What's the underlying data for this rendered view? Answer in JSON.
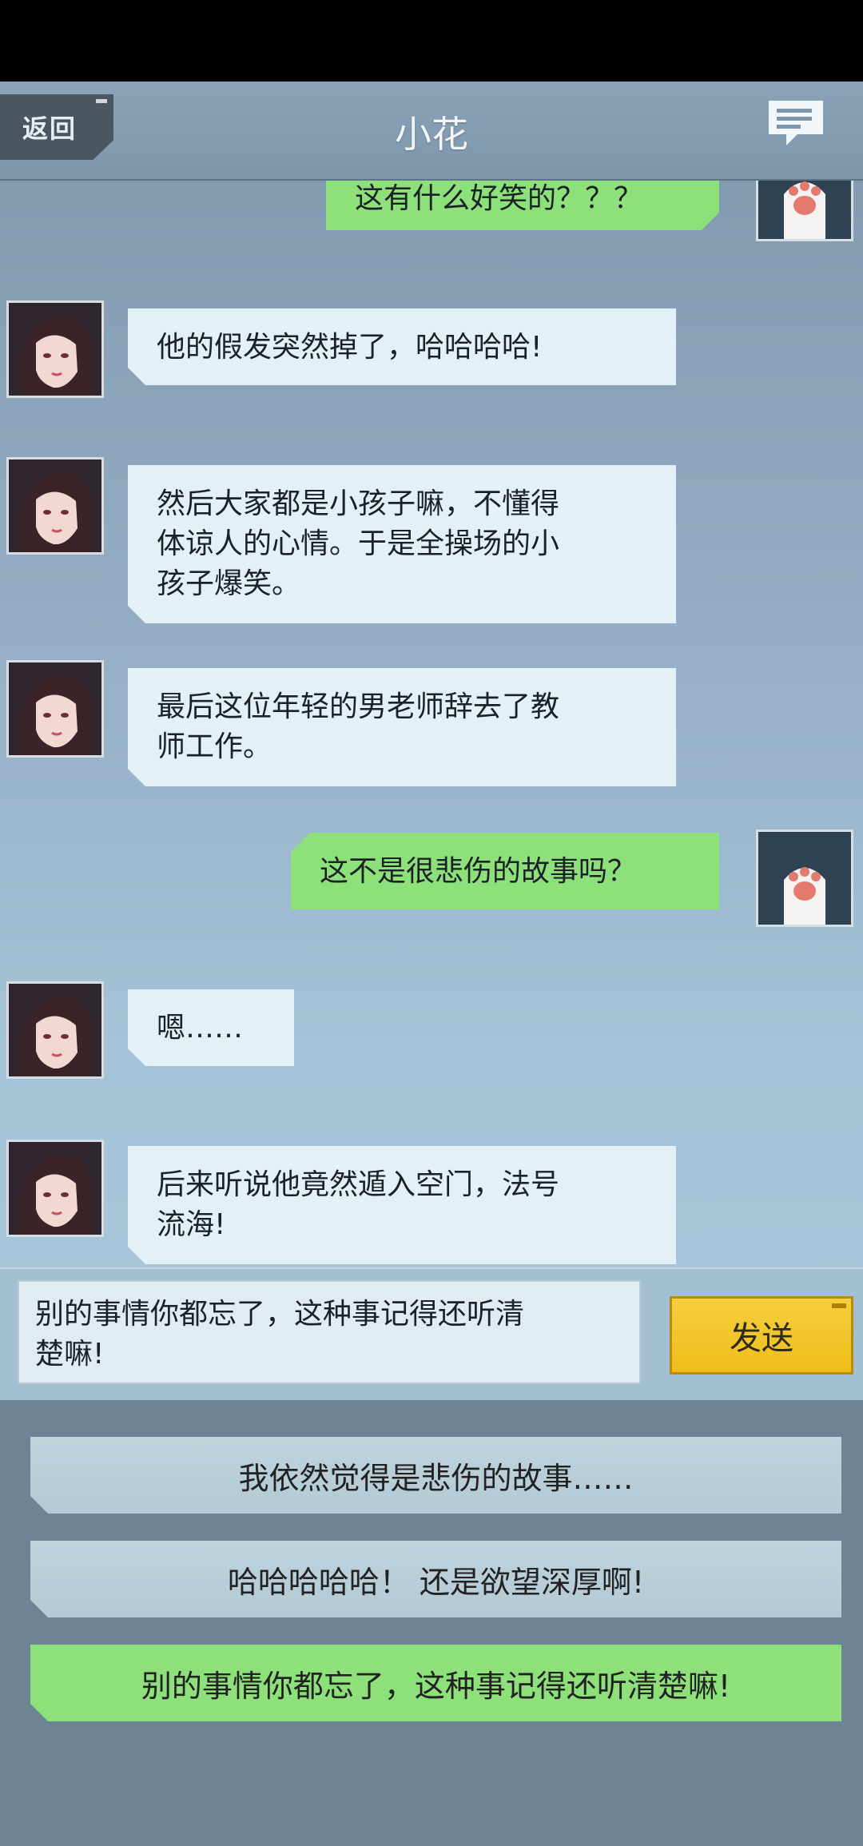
{
  "header": {
    "back_label": "返回",
    "title": "小花",
    "chat_icon": "chat-bubble-icon"
  },
  "messages": [
    {
      "side": "right",
      "avatar": "cat-paw",
      "text": "这有什么好笑的？？？"
    },
    {
      "side": "left",
      "avatar": "girl",
      "text": "他的假发突然掉了，哈哈哈哈!"
    },
    {
      "side": "left",
      "avatar": "girl",
      "lines": [
        "然后大家都是小孩子嘛，不懂得",
        "体谅人的心情。于是全操场的小",
        "孩子爆笑。"
      ]
    },
    {
      "side": "left",
      "avatar": "girl",
      "lines": [
        "最后这位年轻的男老师辞去了教",
        "师工作。"
      ]
    },
    {
      "side": "right",
      "avatar": "cat-paw",
      "text": "这不是很悲伤的故事吗？"
    },
    {
      "side": "left",
      "avatar": "girl",
      "text": "嗯……"
    },
    {
      "side": "left",
      "avatar": "girl",
      "lines": [
        "后来听说他竟然遁入空门，法号",
        "流海!"
      ]
    }
  ],
  "input": {
    "lines": [
      "别的事情你都忘了，这种事记得还听清",
      "楚嘛!"
    ],
    "send_label": "发送"
  },
  "options": [
    {
      "label": "我依然觉得是悲伤的故事……",
      "selected": false
    },
    {
      "label": "哈哈哈哈哈！ 还是欲望深厚啊!",
      "selected": false
    },
    {
      "label": "别的事情你都忘了，这种事记得还听清楚嘛!",
      "selected": true
    }
  ],
  "colors": {
    "bubble_left": "#e3f0f6",
    "bubble_right": "#8ee17a",
    "send_button": "#f2c52a",
    "option_selected": "#8ee17a"
  }
}
